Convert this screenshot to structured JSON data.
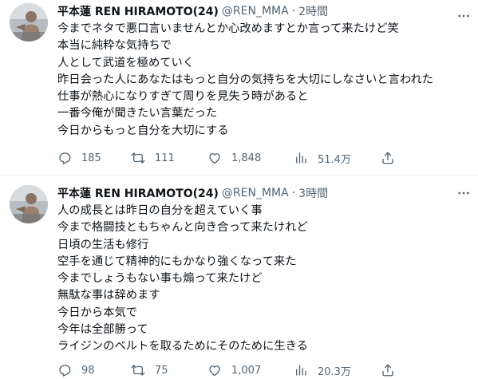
{
  "tweets": [
    {
      "display_name": "平本蓮 REN HIRAMOTO(24)",
      "handle": "@REN_MMA",
      "separator": "·",
      "time": "2時間",
      "lines": [
        "今までネタで悪口言いませんとか心改めますとか言って来たけど笑",
        "本当に純粋な気持ちで",
        "人として武道を極めていく",
        "昨日会った人にあなたはもっと自分の気持ちを大切にしなさいと言われた",
        "仕事が熱心になりすぎて周りを見失う時があると",
        "一番今俺が聞きたい言葉だった",
        "今日からもっと自分を大切にする"
      ],
      "replies": "185",
      "retweets": "111",
      "likes": "1,848",
      "views": "51.4万"
    },
    {
      "display_name": "平本蓮 REN HIRAMOTO(24)",
      "handle": "@REN_MMA",
      "separator": "·",
      "time": "3時間",
      "lines": [
        "人の成長とは昨日の自分を超えていく事",
        "今まで格闘技ともちゃんと向き合って来たけれど",
        "日頃の生活も修行",
        "空手を通じて精神的にもかなり強くなって来た",
        "今までしょうもない事も煽って来たけど",
        "無駄な事は辞めます",
        "今日から本気で",
        "今年は全部勝って",
        "ライジンのベルトを取るためにそのために生きる"
      ],
      "replies": "98",
      "retweets": "75",
      "likes": "1,007",
      "views": "20.3万"
    }
  ],
  "icons": {
    "avatar": "avatar-photo",
    "more": "more-dots-icon",
    "reply": "reply-icon",
    "retweet": "retweet-icon",
    "like": "heart-icon",
    "views": "views-chart-icon",
    "share": "share-icon"
  },
  "colors": {
    "text_primary": "#0f1419",
    "text_secondary": "#536471",
    "divider": "#eff3f4"
  }
}
